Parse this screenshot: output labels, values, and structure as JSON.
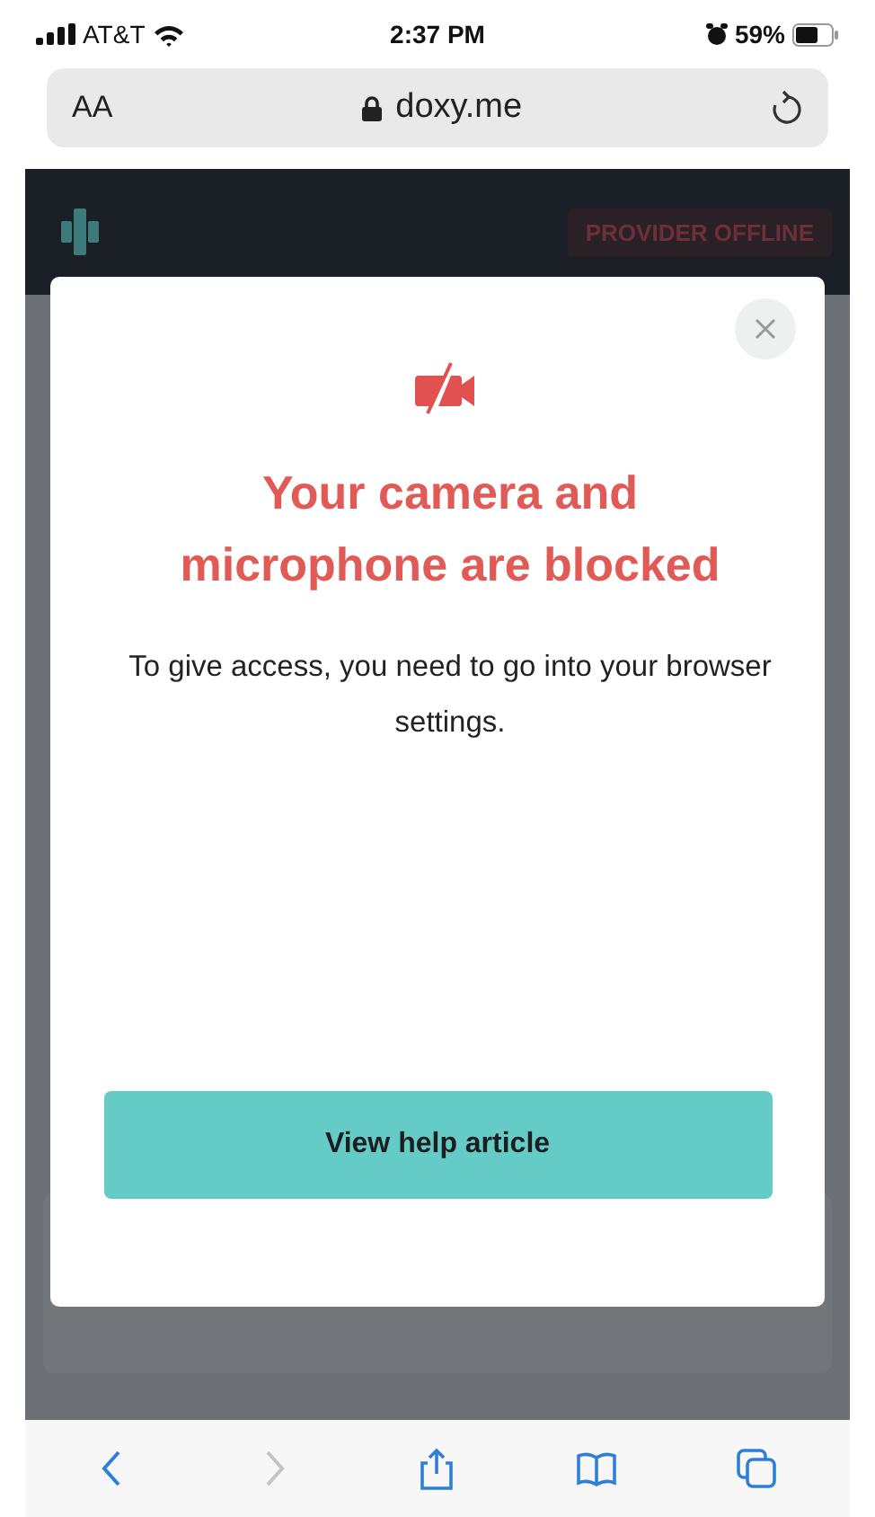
{
  "status_bar": {
    "carrier": "AT&T",
    "time": "2:37 PM",
    "battery": "59%"
  },
  "address_bar": {
    "text_size": "AA",
    "url": "doxy.me"
  },
  "header": {
    "status_badge": "PROVIDER OFFLINE"
  },
  "dialog": {
    "title": "Your camera and microphone are blocked",
    "message": "To give access, you need to go into your browser settings.",
    "button": "View help article"
  },
  "toolbar": [
    {
      "kind": "back",
      "disabled": false
    },
    {
      "kind": "forward",
      "disabled": true
    },
    {
      "kind": "share",
      "disabled": false
    },
    {
      "kind": "bookmarks",
      "disabled": false
    },
    {
      "kind": "tabs",
      "disabled": false
    }
  ]
}
